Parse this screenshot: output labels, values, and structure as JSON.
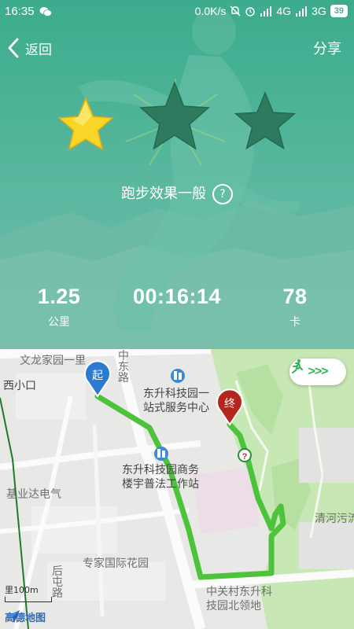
{
  "status_bar": {
    "time": "16:35",
    "speed": "0.0K/s",
    "net1": "4G",
    "net2": "3G",
    "battery": "39"
  },
  "nav": {
    "back_label": "返回",
    "share_label": "分享"
  },
  "rating": {
    "stars_filled": 1,
    "stars_total": 3,
    "star_color": "#f7d628",
    "empty_star_color": "#2e7a5f"
  },
  "effect_text": "跑步效果一般",
  "help_glyph": "?",
  "stats": {
    "distance": {
      "value": "1.25",
      "unit": "公里"
    },
    "duration": {
      "value": "00:16:14",
      "unit": ""
    },
    "calories": {
      "value": "78",
      "unit": "卡"
    }
  },
  "map": {
    "start_label": "起",
    "end_label": "终",
    "route_color": "#4cc33a",
    "labels": {
      "l1": "文龙家园一里",
      "l2": "西小口",
      "l3": "东升科技园一",
      "l4": "站式服务中心",
      "l5": "东升科技园商务",
      "l6": "楼宇普法工作站",
      "l7": "基业达电气",
      "l8": "专家国际花园",
      "l9": "中关村东升科",
      "l10": "技园北领地",
      "l11": "清河污流",
      "road1": "中东路",
      "road2": "后屯路"
    },
    "scale_label": "100m",
    "scale_char": "里",
    "logo_text": "高德地图"
  }
}
